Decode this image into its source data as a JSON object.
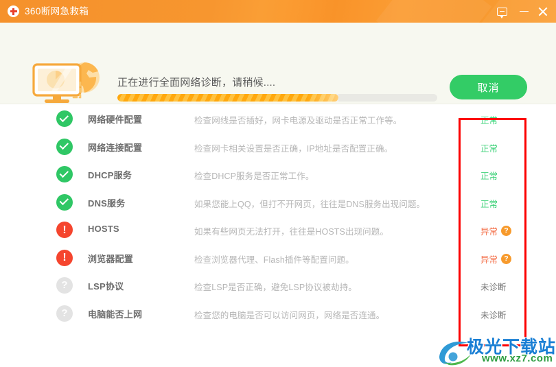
{
  "window": {
    "title": "360断网急救箱",
    "logo_icon": "first-aid-cross-icon",
    "controls": {
      "feedback_icon": "feedback-message-icon",
      "minimize_icon": "minimize-icon",
      "close_icon": "close-icon"
    }
  },
  "header": {
    "illustration_icon": "monitor-globe-network-icon",
    "status_text": "正在进行全面网络诊断，请稍候....",
    "progress_percent": 69,
    "cancel_label": "取消"
  },
  "diagnostics": {
    "rows": [
      {
        "icon": "check-circle-icon",
        "state": "ok",
        "name": "网络硬件配置",
        "desc": "检查网线是否插好，网卡电源及驱动是否正常工作等。",
        "status": "正常",
        "has_help": false
      },
      {
        "icon": "check-circle-icon",
        "state": "ok",
        "name": "网络连接配置",
        "desc": "检查网卡相关设置是否正确，IP地址是否配置正确。",
        "status": "正常",
        "has_help": false
      },
      {
        "icon": "check-circle-icon",
        "state": "ok",
        "name": "DHCP服务",
        "desc": "检查DHCP服务是否正常工作。",
        "status": "正常",
        "has_help": false
      },
      {
        "icon": "check-circle-icon",
        "state": "ok",
        "name": "DNS服务",
        "desc": "如果您能上QQ，但打不开网页，往往是DNS服务出现问题。",
        "status": "正常",
        "has_help": false
      },
      {
        "icon": "exclamation-circle-icon",
        "state": "err",
        "name": "HOSTS",
        "desc": "如果有些网页无法打开，往往是HOSTS出现问题。",
        "status": "异常",
        "has_help": true,
        "help_label": "?"
      },
      {
        "icon": "exclamation-circle-icon",
        "state": "err",
        "name": "浏览器配置",
        "desc": "检查浏览器代理、Flash插件等配置问题。",
        "status": "异常",
        "has_help": true,
        "help_label": "?"
      },
      {
        "icon": "question-circle-icon",
        "state": "none",
        "name": "LSP协议",
        "desc": "检查LSP是否正确，避免LSP协议被劫持。",
        "status": "未诊断",
        "has_help": false
      },
      {
        "icon": "question-circle-icon",
        "state": "none",
        "name": "电脑能否上网",
        "desc": "检查您的电脑是否可以访问网页，网络是否连通。",
        "status": "未诊断",
        "has_help": false
      }
    ]
  },
  "annotation": {
    "name": "status-column-highlight",
    "color": "#fc0000"
  },
  "watermark": {
    "site_name": "极光下载站",
    "url": "www.xz7.com"
  },
  "colors": {
    "title_orange": "#f8992f",
    "ok_green": "#2fc765",
    "error_red": "#f5452e",
    "cancel_green": "#33cc66",
    "progress_orange": "#ffa80d",
    "help_orange": "#f79a2c"
  }
}
